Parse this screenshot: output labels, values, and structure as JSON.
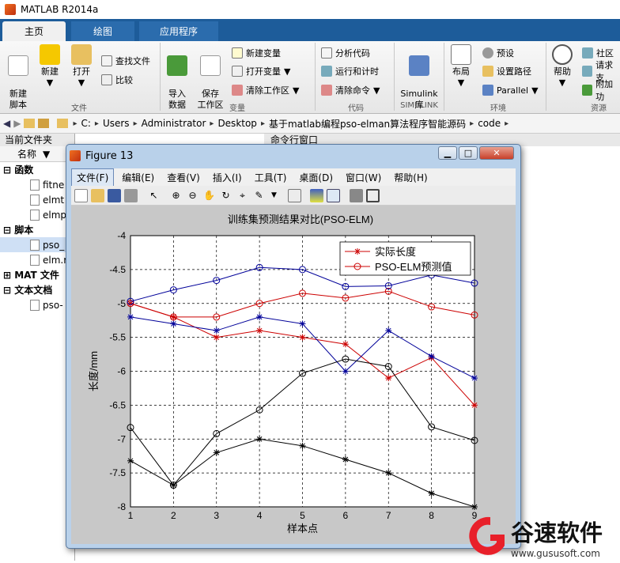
{
  "window": {
    "title": "MATLAB R2014a"
  },
  "tabs": [
    {
      "label": "主页"
    },
    {
      "label": "绘图"
    },
    {
      "label": "应用程序"
    }
  ],
  "ribbon": {
    "file": {
      "new_script": "新建\n脚本",
      "new": "新建",
      "open": "打开",
      "find_files": "查找文件",
      "compare": "比较",
      "section": "文件"
    },
    "variable": {
      "import": "导入\n数据",
      "save_ws": "保存\n工作区",
      "new_var": "新建变量",
      "open_var": "打开变量",
      "clear_ws": "清除工作区",
      "section": "变量"
    },
    "code": {
      "analyze": "分析代码",
      "run_time": "运行和计时",
      "clear_cmd": "清除命令",
      "section": "代码"
    },
    "simulink": {
      "library": "Simulink\n库",
      "section": "SIMULINK"
    },
    "env": {
      "layout": "布局",
      "prefs": "预设",
      "set_path": "设置路径",
      "parallel": "Parallel",
      "section": "环境"
    },
    "resources": {
      "help": "帮助",
      "community": "社区",
      "request": "请求支",
      "addons": "附加功",
      "section": "资源"
    }
  },
  "address": {
    "crumbs": [
      "C:",
      "Users",
      "Administrator",
      "Desktop",
      "基于matlab编程pso-elman算法程序智能源码",
      "code"
    ]
  },
  "left_panel": {
    "title": "当前文件夹",
    "col_name": "名称",
    "groups": [
      {
        "label": "函数",
        "items": [
          "fitne",
          "elmt",
          "elmp"
        ]
      },
      {
        "label": "脚本",
        "items": [
          "pso_",
          "elm.r"
        ]
      },
      {
        "label": "MAT 文件",
        "items": []
      },
      {
        "label": "文本文档",
        "items": [
          "pso-"
        ]
      }
    ]
  },
  "cmd_window": {
    "title": "命令行窗口"
  },
  "figure": {
    "title": "Figure 13",
    "menus": [
      "文件(F)",
      "编辑(E)",
      "查看(V)",
      "插入(I)",
      "工具(T)",
      "桌面(D)",
      "窗口(W)",
      "帮助(H)"
    ]
  },
  "chart_data": {
    "type": "line",
    "title": "训练集预测结果对比(PSO-ELM)",
    "xlabel": "样本点",
    "ylabel": "长度/mm",
    "xlim": [
      1,
      9
    ],
    "ylim": [
      -8,
      -4
    ],
    "xticks": [
      "1",
      "2",
      "3",
      "4",
      "5",
      "6",
      "7",
      "8",
      "9"
    ],
    "yticks": [
      "-4",
      "-4.5",
      "-5",
      "-5.5",
      "-6",
      "-6.5",
      "-7",
      "-7.5",
      "-8"
    ],
    "grid": true,
    "legend_position": "top-right",
    "x": [
      1,
      2,
      3,
      4,
      5,
      6,
      7,
      8,
      9
    ],
    "series": [
      {
        "name": "实际长度",
        "marker": "star",
        "color": "#cc0000",
        "values": [
          -5.0,
          -5.2,
          -5.5,
          -5.4,
          -5.5,
          -5.6,
          -6.1,
          -5.8,
          -6.5
        ]
      },
      {
        "name": "PSO-ELM预测值",
        "marker": "circle",
        "color": "#cc0000",
        "values": [
          -5.0,
          -5.2,
          -5.2,
          -5.0,
          -4.85,
          -4.92,
          -4.82,
          -5.05,
          -5.17
        ]
      },
      {
        "marker": "circle",
        "color": "#000099",
        "values": [
          -4.97,
          -4.8,
          -4.66,
          -4.47,
          -4.5,
          -4.75,
          -4.74,
          -4.58,
          -4.7
        ]
      },
      {
        "marker": "star",
        "color": "#000099",
        "values": [
          -5.2,
          -5.3,
          -5.4,
          -5.2,
          -5.3,
          -6.0,
          -5.4,
          -5.78,
          -6.1
        ]
      },
      {
        "marker": "circle",
        "color": "#000000",
        "values": [
          -6.83,
          -7.68,
          -6.92,
          -6.57,
          -6.03,
          -5.82,
          -5.93,
          -6.82,
          -7.02
        ]
      },
      {
        "marker": "star",
        "color": "#000000",
        "values": [
          -7.32,
          -7.68,
          -7.2,
          -7.0,
          -7.1,
          -7.3,
          -7.5,
          -7.8,
          -8.0
        ]
      }
    ]
  },
  "watermark": {
    "brand": "谷速软件",
    "url": "www.gususoft.com",
    "accent": "#e8202a"
  }
}
